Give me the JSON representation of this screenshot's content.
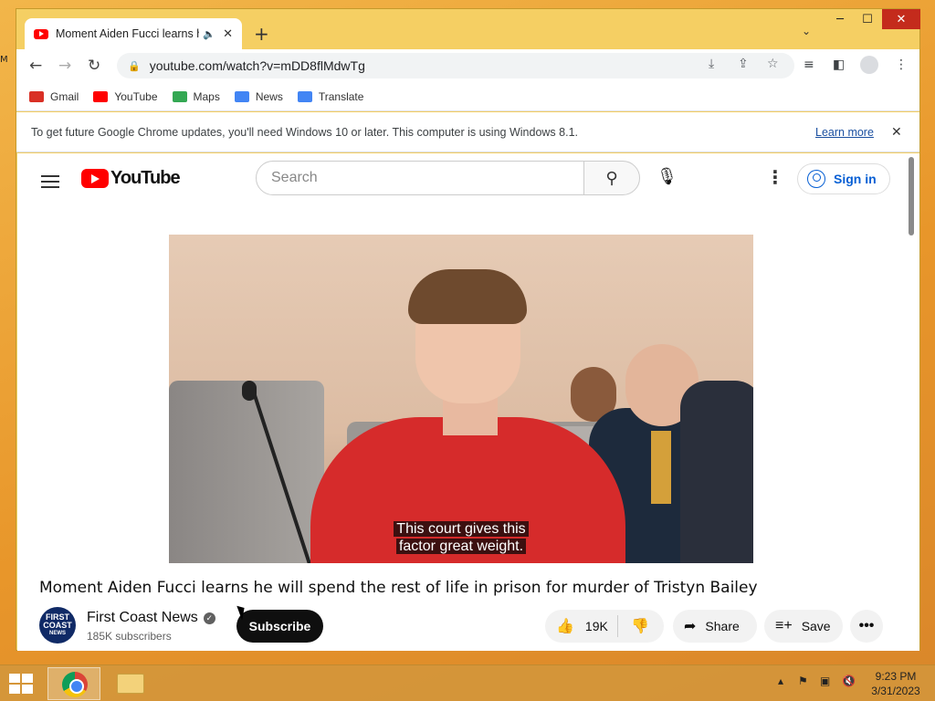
{
  "tab": {
    "title": "Moment Aiden Fucci learns he will spend the rest of life in prison"
  },
  "window": {
    "new_tab_label": "+",
    "minimize": "─",
    "maximize": "☐",
    "close": "✕"
  },
  "omnibox": {
    "url": "youtube.com/watch?v=mDD8flMdwTg"
  },
  "bookmarks": [
    {
      "label": "Gmail",
      "color": "#d93025"
    },
    {
      "label": "YouTube",
      "color": "#ff0000"
    },
    {
      "label": "Maps",
      "color": "#34a853"
    },
    {
      "label": "News",
      "color": "#4285f4"
    },
    {
      "label": "Translate",
      "color": "#4285f4"
    }
  ],
  "infobar": {
    "message": "To get future Google Chrome updates, you'll need Windows 10 or later. This computer is using Windows 8.1.",
    "learn_more": "Learn more"
  },
  "youtube": {
    "logo_text": "YouTube",
    "search_placeholder": "Search",
    "sign_in": "Sign in"
  },
  "video": {
    "caption_line1": "This court gives this",
    "caption_line2": "factor great weight.",
    "title": "Moment Aiden Fucci learns he will spend the rest of life in prison for murder of Tristyn Bailey"
  },
  "channel": {
    "logo_line1": "FIRST",
    "logo_line2": "COAST",
    "logo_line3": "NEWS",
    "name": "First Coast News",
    "subscribers": "185K subscribers",
    "subscribe_label": "Subscribe"
  },
  "actions": {
    "likes": "19K",
    "share": "Share",
    "save": "Save",
    "more": "•••"
  },
  "taskbar": {
    "time": "9:23 PM",
    "date": "3/31/2023"
  }
}
